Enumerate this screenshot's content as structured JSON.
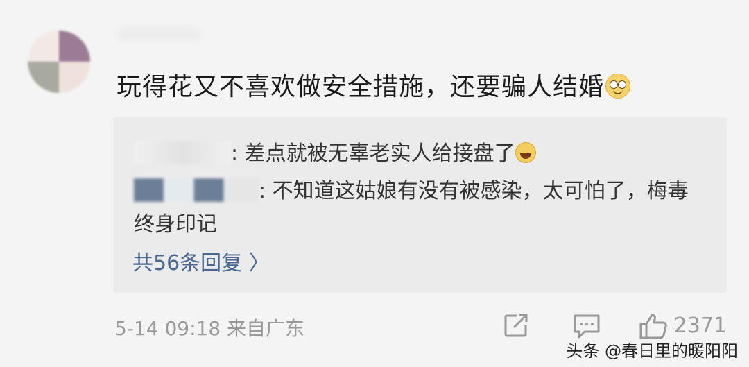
{
  "comment": {
    "text": "玩得花又不喜欢做安全措施，还要骗人结婚",
    "emoji_icon": "drooling-face-emoji"
  },
  "replies": [
    {
      "text": ": 差点就被无辜老实人给接盘了",
      "emoji_icon": "laughing-crying-emoji"
    },
    {
      "text": ": 不知道这姑娘有没有被感染，太可怕了，梅毒终身印记"
    }
  ],
  "more_replies": "共56条回复 〉",
  "meta": {
    "time": "5-14 09:18 来自广东",
    "like_count": "2371"
  },
  "icons": [
    "share-icon",
    "comment-icon",
    "like-icon"
  ],
  "watermark": "头条 @春日里的暖阳阳",
  "colors": {
    "link": "#4a6790",
    "meta": "#9a9a9a",
    "reply_bg": "#ebebeb"
  }
}
